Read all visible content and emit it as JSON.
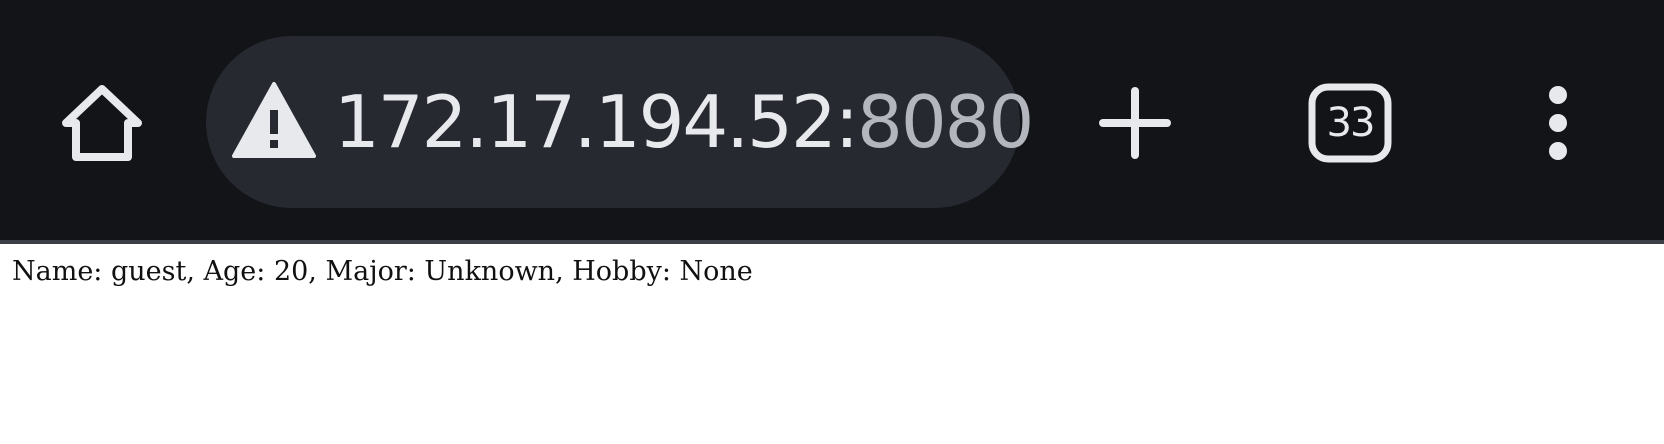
{
  "toolbar": {
    "address_host": "172.17.194.52:",
    "address_port": "8080",
    "tab_count": "33",
    "icons": {
      "home": "home-icon",
      "security": "warning-icon",
      "new_tab": "plus-icon",
      "tabs": "tab-switcher-icon",
      "menu": "more-vert-icon"
    }
  },
  "page": {
    "text": "Name: guest, Age: 20, Major: Unknown, Hobby: None"
  },
  "colors": {
    "toolbar_bg": "#131418",
    "omnibox_bg": "#272931",
    "icon": "#e8e9ed"
  }
}
